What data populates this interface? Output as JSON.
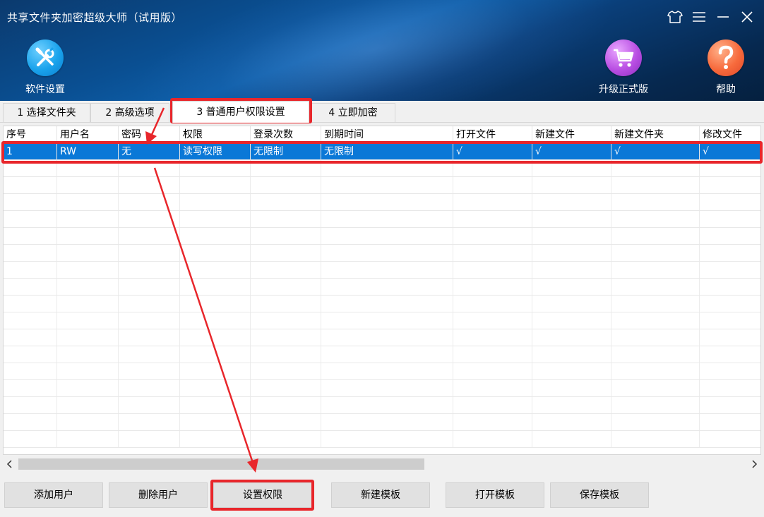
{
  "app": {
    "title": "共享文件夹加密超级大师（试用版）"
  },
  "window_controls": [
    "shirt-icon",
    "menu-icon",
    "minimize-icon",
    "close-icon"
  ],
  "toolbar": {
    "settings_label": "软件设置",
    "upgrade_label": "升级正式版",
    "help_label": "帮助"
  },
  "tabs": [
    {
      "label": "1 选择文件夹"
    },
    {
      "label": "2 高级选项"
    },
    {
      "label": "3 普通用户权限设置"
    },
    {
      "label": "4 立即加密"
    }
  ],
  "table": {
    "columns": [
      "序号",
      "用户名",
      "密码",
      "权限",
      "登录次数",
      "到期时间",
      "打开文件",
      "新建文件",
      "新建文件夹",
      "修改文件"
    ],
    "rows": [
      [
        "1",
        "RW",
        "无",
        "读写权限",
        "无限制",
        "无限制",
        "√",
        "√",
        "√",
        "√"
      ]
    ]
  },
  "buttons": {
    "add_user": "添加用户",
    "delete_user": "删除用户",
    "set_permission": "设置权限",
    "new_template": "新建模板",
    "open_template": "打开模板",
    "save_template": "保存模板"
  },
  "colors": {
    "selection": "#0a78d7",
    "annotation": "#e8262b",
    "header": "#0a4f92"
  }
}
